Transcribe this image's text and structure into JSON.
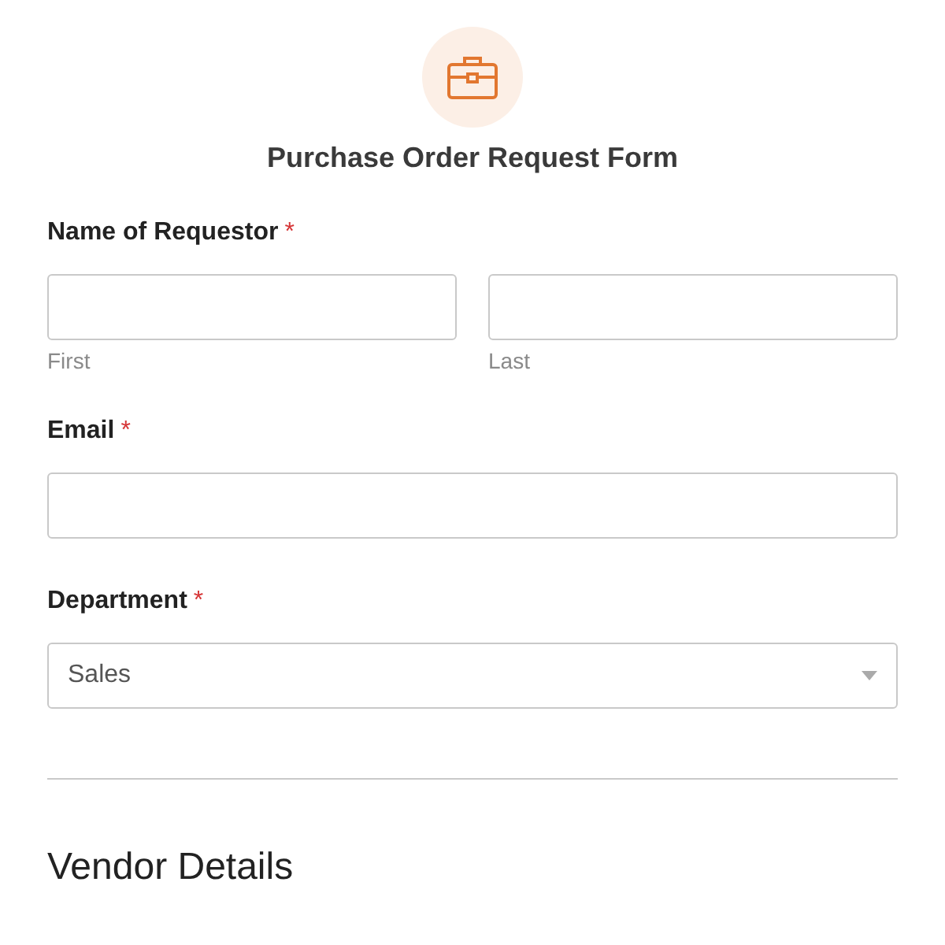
{
  "form": {
    "title": "Purchase Order Request Form"
  },
  "fields": [
    {
      "kind": "name",
      "label": "Name of Requestor",
      "required": true,
      "required_mark": "*",
      "sublabels": [
        "First",
        "Last"
      ]
    },
    {
      "kind": "text",
      "label": "Email",
      "required": true,
      "required_mark": "*"
    },
    {
      "kind": "select",
      "label": "Department",
      "required": true,
      "required_mark": "*",
      "value": "Sales"
    }
  ],
  "section": {
    "heading": "Vendor Details"
  }
}
